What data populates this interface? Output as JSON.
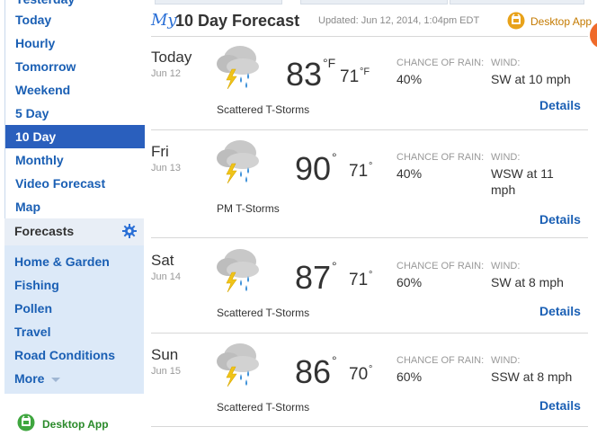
{
  "sidebar": {
    "nav": [
      {
        "label": "Yesterday",
        "active": false
      },
      {
        "label": "Today",
        "active": false
      },
      {
        "label": "Hourly",
        "active": false
      },
      {
        "label": "Tomorrow",
        "active": false
      },
      {
        "label": "Weekend",
        "active": false
      },
      {
        "label": "5 Day",
        "active": false
      },
      {
        "label": "10 Day",
        "active": true
      },
      {
        "label": "Monthly",
        "active": false
      },
      {
        "label": "Video Forecast",
        "active": false
      },
      {
        "label": "Map",
        "active": false
      }
    ],
    "forecasts_title": "Forecasts",
    "forecast_links": [
      "Home & Garden",
      "Fishing",
      "Pollen",
      "Travel",
      "Road Conditions"
    ],
    "more_label": "More",
    "desktop_app_label": "Desktop App"
  },
  "header": {
    "title_my": "My",
    "title": "10 Day Forecast",
    "updated": "Updated: Jun 12, 2014, 1:04pm EDT",
    "desktop_app_label": "Desktop App"
  },
  "days": [
    {
      "name": "Today",
      "date": "Jun 12",
      "condition": "Scattered T-Storms",
      "high": "83",
      "high_unit": "°F",
      "low": "71",
      "low_unit": "°F",
      "rain_label": "CHANCE OF RAIN:",
      "rain": "40%",
      "wind_label": "WIND:",
      "wind": "SW at 10 mph",
      "details": "Details"
    },
    {
      "name": "Fri",
      "date": "Jun 13",
      "condition": "PM T-Storms",
      "high": "90",
      "high_unit": "°",
      "low": "71",
      "low_unit": "°",
      "rain_label": "CHANCE OF RAIN:",
      "rain": "40%",
      "wind_label": "WIND:",
      "wind": "WSW at 11 mph",
      "details": "Details"
    },
    {
      "name": "Sat",
      "date": "Jun 14",
      "condition": "Scattered T-Storms",
      "high": "87",
      "high_unit": "°",
      "low": "71",
      "low_unit": "°",
      "rain_label": "CHANCE OF RAIN:",
      "rain": "60%",
      "wind_label": "WIND:",
      "wind": "SW at 8 mph",
      "details": "Details"
    },
    {
      "name": "Sun",
      "date": "Jun 15",
      "condition": "Scattered T-Storms",
      "high": "86",
      "high_unit": "°",
      "low": "70",
      "low_unit": "°",
      "rain_label": "CHANCE OF RAIN:",
      "rain": "60%",
      "wind_label": "WIND:",
      "wind": "SSW at 8 mph",
      "details": "Details"
    }
  ],
  "icons": {
    "weather": "thunderstorm-icon",
    "gear": "gear-icon",
    "desktop_app": "desktop-app-icon"
  },
  "colors": {
    "link": "#1a5fb4",
    "active_nav": "#2a5fbd",
    "sidebar_bg": "#dce9f8",
    "desktop_app_side": "#2a8a2a",
    "desktop_app_top": "#c47a00"
  }
}
